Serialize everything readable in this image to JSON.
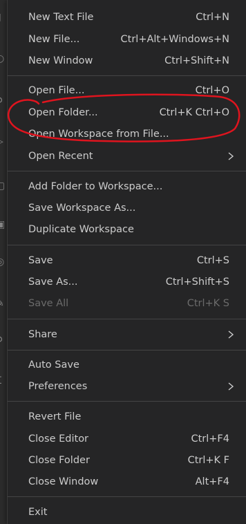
{
  "menu": {
    "items": [
      {
        "label": "New Text File",
        "shortcut": "Ctrl+N"
      },
      {
        "label": "New File...",
        "shortcut": "Ctrl+Alt+Windows+N"
      },
      {
        "label": "New Window",
        "shortcut": "Ctrl+Shift+N"
      },
      {
        "label": "Open File...",
        "shortcut": "Ctrl+O"
      },
      {
        "label": "Open Folder...",
        "shortcut": "Ctrl+K Ctrl+O"
      },
      {
        "label": "Open Workspace from File...",
        "shortcut": ""
      },
      {
        "label": "Open Recent",
        "shortcut": ""
      },
      {
        "label": "Add Folder to Workspace...",
        "shortcut": ""
      },
      {
        "label": "Save Workspace As...",
        "shortcut": ""
      },
      {
        "label": "Duplicate Workspace",
        "shortcut": ""
      },
      {
        "label": "Save",
        "shortcut": "Ctrl+S"
      },
      {
        "label": "Save As...",
        "shortcut": "Ctrl+Shift+S"
      },
      {
        "label": "Save All",
        "shortcut": "Ctrl+K S"
      },
      {
        "label": "Share",
        "shortcut": ""
      },
      {
        "label": "Auto Save",
        "shortcut": ""
      },
      {
        "label": "Preferences",
        "shortcut": ""
      },
      {
        "label": "Revert File",
        "shortcut": ""
      },
      {
        "label": "Close Editor",
        "shortcut": "Ctrl+F4"
      },
      {
        "label": "Close Folder",
        "shortcut": "Ctrl+K F"
      },
      {
        "label": "Close Window",
        "shortcut": "Alt+F4"
      },
      {
        "label": "Exit",
        "shortcut": ""
      }
    ],
    "disabled_items": [
      "Save All"
    ],
    "submenu_items": [
      "Open Recent",
      "Share",
      "Preferences"
    ]
  },
  "annotation": {
    "type": "hand-drawn circle",
    "highlights": "Open Folder...",
    "color": "#e0141e"
  },
  "colors": {
    "menu_bg": "#252526",
    "text": "#cccccc",
    "disabled_text": "#6b6b6b",
    "separator": "#454545"
  }
}
